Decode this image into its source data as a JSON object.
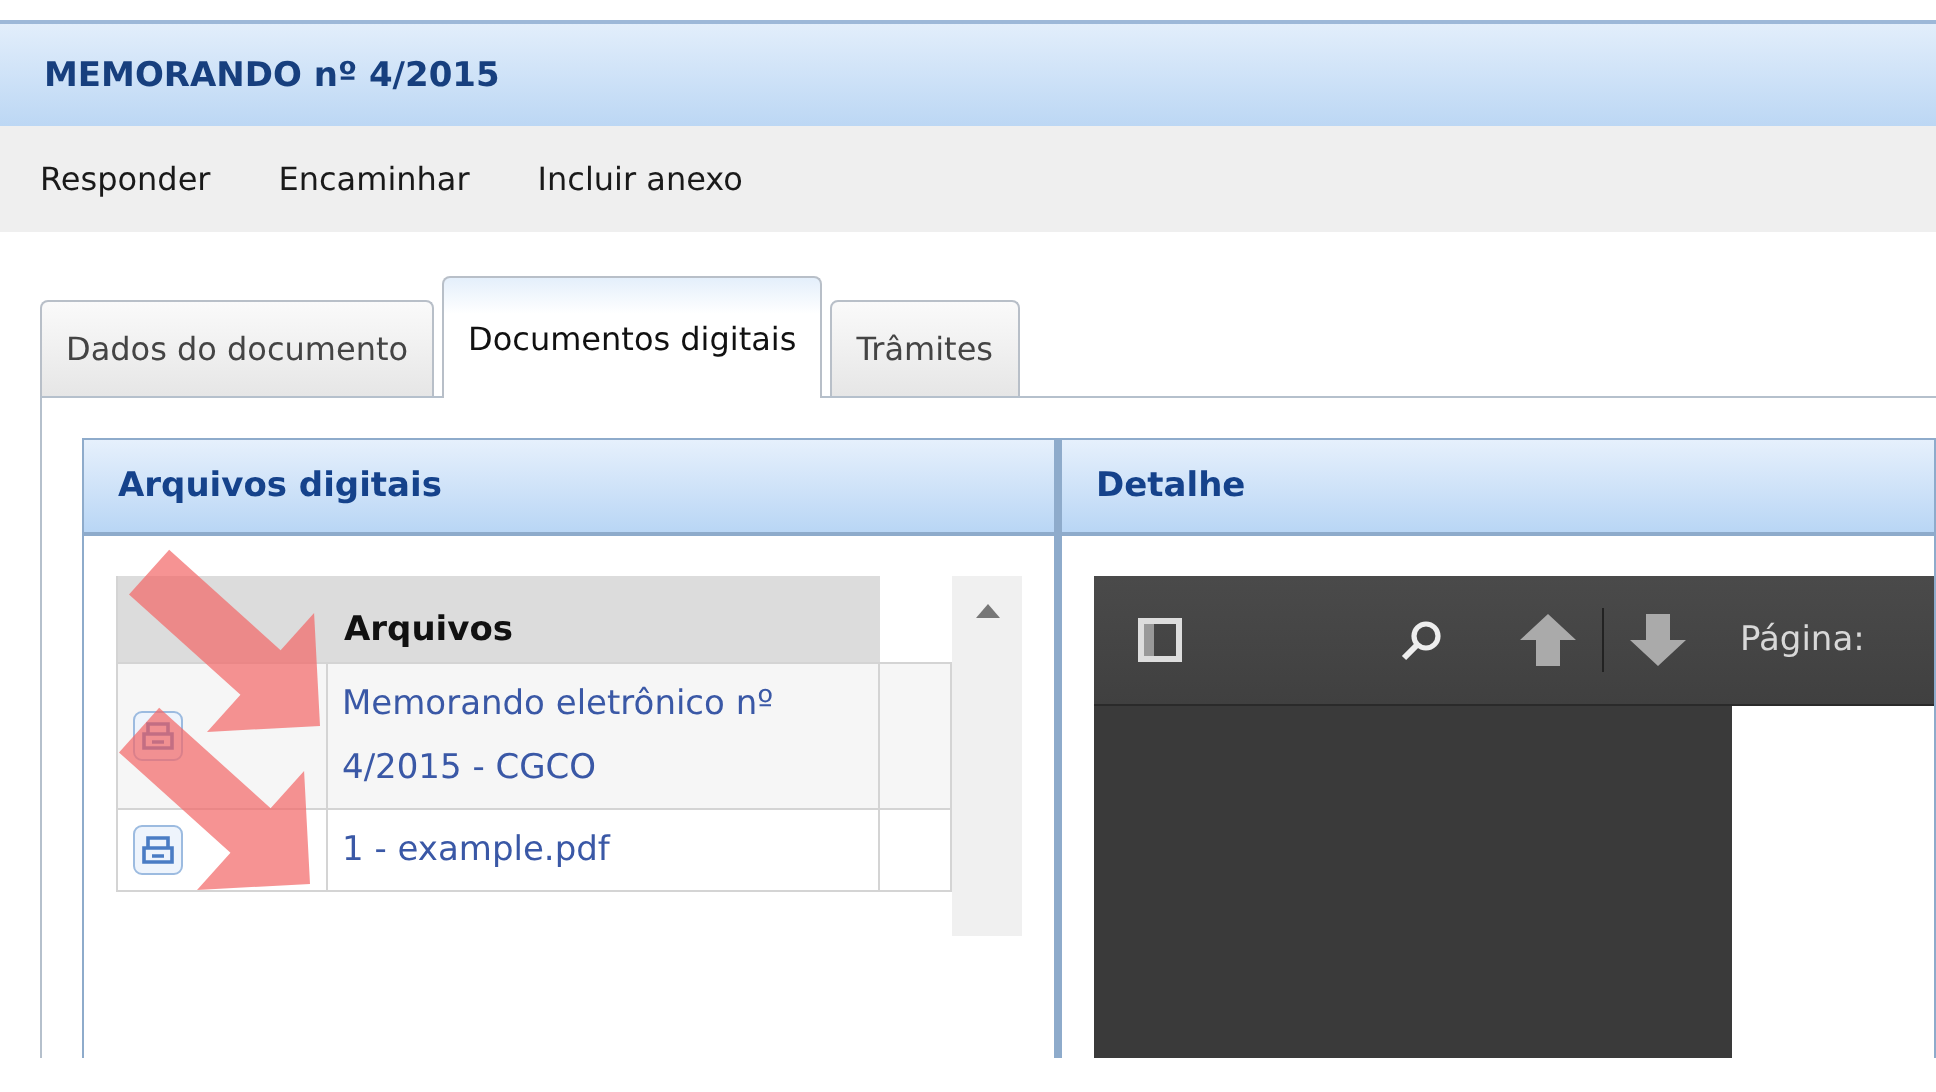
{
  "window": {
    "title": "MEMORANDO nº 4/2015"
  },
  "toolbar": [
    "Responder",
    "Encaminhar",
    "Incluir anexo"
  ],
  "tabs": [
    {
      "label": "Dados do documento",
      "selected": false
    },
    {
      "label": "Documentos digitais",
      "selected": true
    },
    {
      "label": "Trâmites",
      "selected": false
    }
  ],
  "files_panel": {
    "title": "Arquivos digitais",
    "column": "Arquivos",
    "rows": [
      {
        "name": "Memorando eletrônico nº 4/2015 - CGCO"
      },
      {
        "name": "1 - example.pdf"
      }
    ]
  },
  "detail_panel": {
    "title": "Detalhe",
    "viewer": {
      "page_label": "Página:"
    }
  }
}
